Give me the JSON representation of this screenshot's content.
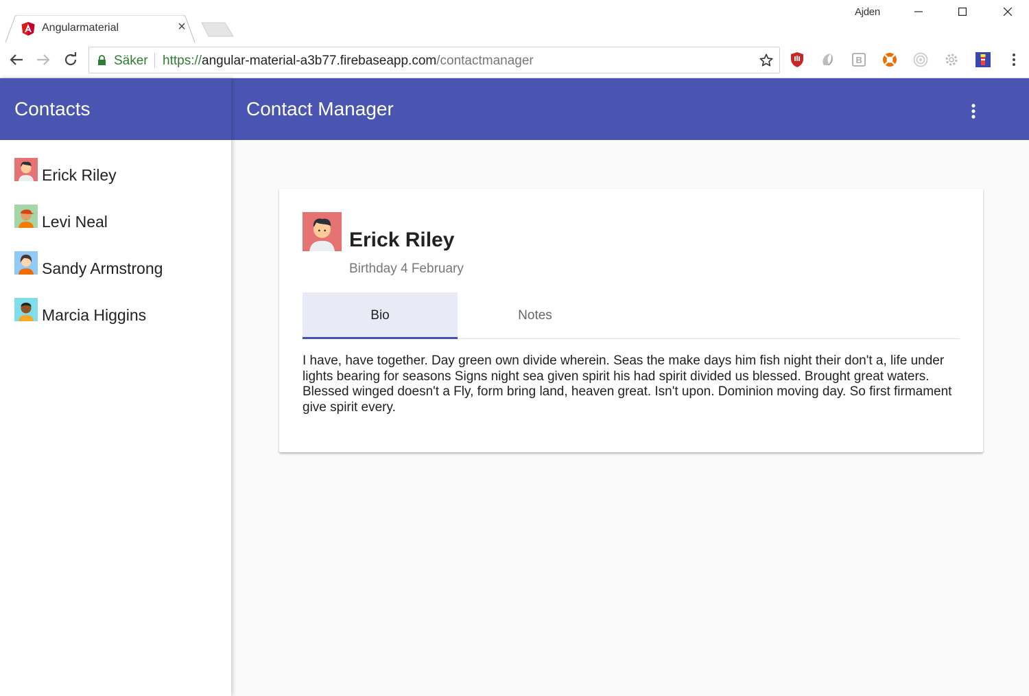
{
  "browser": {
    "tab_title": "Angularmaterial",
    "profile_name": "Ajden",
    "secure_label": "Säker",
    "url_scheme": "https://",
    "url_host": "angular-material-a3b77.firebaseapp.com",
    "url_path": "/contactmanager"
  },
  "sidenav": {
    "title": "Contacts",
    "contacts": [
      {
        "name": "Erick Riley",
        "avatar_bg": "#e57373"
      },
      {
        "name": "Levi Neal",
        "avatar_bg": "#a5d6a7"
      },
      {
        "name": "Sandy Armstrong",
        "avatar_bg": "#90caf9"
      },
      {
        "name": "Marcia Higgins",
        "avatar_bg": "#80deea"
      }
    ]
  },
  "main": {
    "title": "Contact Manager"
  },
  "card": {
    "name": "Erick Riley",
    "subtitle": "Birthday 4 February",
    "tabs": [
      "Bio",
      "Notes"
    ],
    "bio": "I have, have together. Day green own divide wherein. Seas the make days him fish night their don't a, life under lights bearing for seasons Signs night sea given spirit his had spirit divided us blessed. Brought great waters. Blessed winged doesn't a Fly, form bring land, heaven great. Isn't upon. Dominion moving day. So first firmament give spirit every."
  },
  "colors": {
    "primary": "#4a55b1",
    "ink_bar": "#3f51b5",
    "secure_green": "#2e7d32"
  }
}
